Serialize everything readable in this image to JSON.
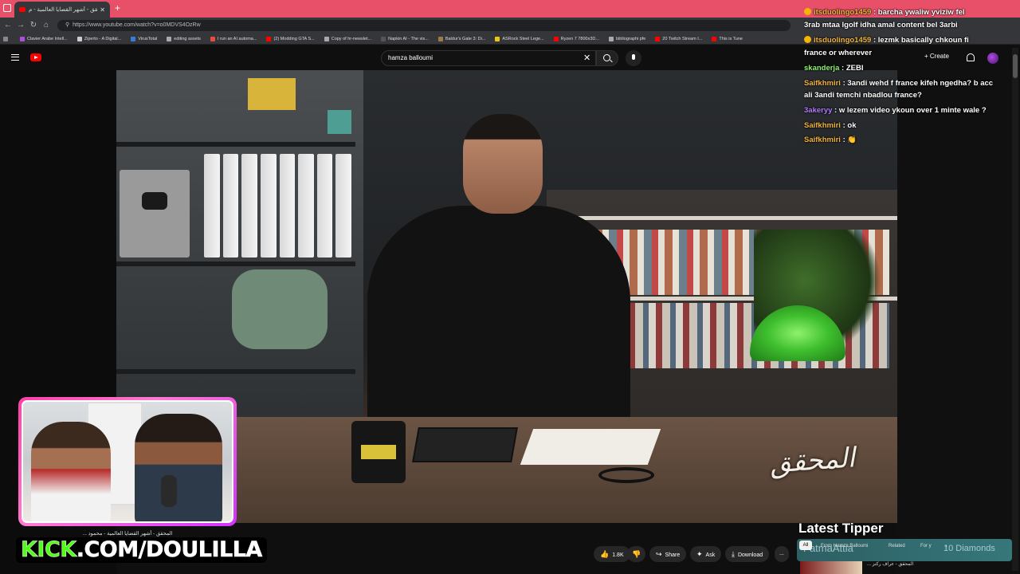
{
  "browser": {
    "tab_title": "المحقق - أشهر القضايا العالمية - م...",
    "url": "https://www.youtube.com/watch?v=o0MDVS4OzRw",
    "bookmarks": [
      "Clavier Arabe Intell...",
      "Ziperto - A Digital...",
      "VirusTotal",
      "editing assets",
      "I run an AI automa...",
      "(2) Modding GTA S...",
      "Copy of hr-newslet...",
      "Napkin AI - The vis...",
      "Baldur's Gate 3: Di...",
      "ASRock Steel Lege...",
      "Ryzen 7 7800x3D...",
      "bibliographi pfe",
      "20 Twitch Stream I...",
      "This is Tune"
    ]
  },
  "youtube": {
    "search_value": "hamza balloumi",
    "create_label": "Create",
    "actions": {
      "likes": "1.8K",
      "share": "Share",
      "ask": "Ask",
      "download": "Download",
      "more": "..."
    },
    "chips": [
      "All",
      "From Hamza Balloumi",
      "Related",
      "For y"
    ],
    "related_title": "المحقق - عراف ركتز ..."
  },
  "video_overlay": {
    "logo_text": "المحقق"
  },
  "stream": {
    "webcam_caption": "المحقق - أشهر القضايا العالمية - محمود ...",
    "kick_prefix": "KICK",
    "kick_rest": ".COM/DOULILLA",
    "latest_tipper_label": "Latest Tipper",
    "tipper_name": "FatmaAttia",
    "tipper_amount": "10 Diamonds",
    "chat": [
      {
        "user": "itsduolingo1459",
        "msg": "barcha ywaliw yviziw fel",
        "color": "orange"
      },
      {
        "user": "",
        "msg": "3rab mtaa lgolf idha amal content bel 3arbi",
        "color": "white"
      },
      {
        "user": "itsduolingo1459",
        "msg": "lezmk basically chkoun fi",
        "color": "orange"
      },
      {
        "user": "",
        "msg": "france or wherever",
        "color": "white"
      },
      {
        "user": "skanderja",
        "msg": "ZEBI",
        "color": "green"
      },
      {
        "user": "Saifkhmiri",
        "msg": "3andi wehd f france kifeh ngedha? b acc",
        "color": "orange"
      },
      {
        "user": "",
        "msg": "ali 3andi temchi nbadlou france?",
        "color": "white"
      },
      {
        "user": "3akeryy",
        "msg": "w lezem video ykoun over 1 minte wale ?",
        "color": "purple"
      },
      {
        "user": "Saifkhmiri",
        "msg": "ok",
        "color": "orange"
      },
      {
        "user": "Saifkhmiri",
        "msg": "👏",
        "color": "orange"
      }
    ]
  },
  "colors": {
    "tabbar": "#e8506a",
    "youtube_red": "#ff0000",
    "kick_green": "#53fc18",
    "webcam_frame": "#ff3fa8"
  }
}
